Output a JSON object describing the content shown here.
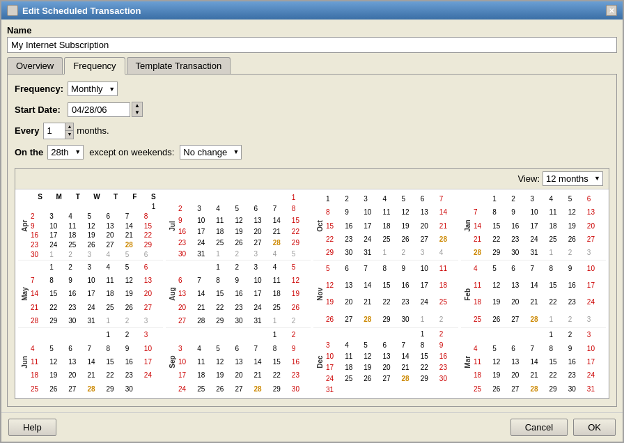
{
  "window": {
    "title": "Edit Scheduled Transaction"
  },
  "name_section": {
    "label": "Name",
    "value": "My Internet Subscription"
  },
  "tabs": [
    {
      "id": "overview",
      "label": "Overview",
      "active": false
    },
    {
      "id": "frequency",
      "label": "Frequency",
      "active": true
    },
    {
      "id": "template",
      "label": "Template Transaction",
      "active": false
    }
  ],
  "form": {
    "frequency_label": "Frequency:",
    "frequency_value": "Monthly",
    "start_date_label": "Start Date:",
    "start_date_value": "04/28/06",
    "every_label": "Every",
    "every_value": "1",
    "every_suffix": "months.",
    "on_the_label": "On the",
    "on_the_value": "28th",
    "except_label": "except on weekends:",
    "except_value": "No change"
  },
  "view": {
    "label": "View:",
    "value": "12 months"
  },
  "buttons": {
    "help": "Help",
    "cancel": "Cancel",
    "ok": "OK"
  },
  "calendars": {
    "months": [
      {
        "label": "Apr",
        "weeks": [
          [
            "",
            "",
            "",
            "",
            "",
            "",
            "1"
          ],
          [
            "2",
            "3",
            "4",
            "5",
            "6",
            "7",
            "8"
          ],
          [
            "9",
            "10",
            "11",
            "12",
            "13",
            "14",
            "15"
          ],
          [
            "16",
            "17",
            "18",
            "19",
            "20",
            "21",
            "22"
          ],
          [
            "23",
            "24",
            "25",
            "26",
            "27",
            "28",
            "29"
          ],
          [
            "30",
            "1",
            "2",
            "3",
            "4",
            "5",
            "6"
          ]
        ],
        "special": [
          "28"
        ],
        "other_month_last_row": [
          "1",
          "2",
          "3",
          "4",
          "5",
          "6"
        ]
      },
      {
        "label": "May",
        "weeks": [
          [
            "",
            "1",
            "2",
            "3",
            "4",
            "5",
            "6"
          ],
          [
            "7",
            "8",
            "9",
            "10",
            "11",
            "12",
            "13"
          ],
          [
            "14",
            "15",
            "16",
            "17",
            "18",
            "19",
            "20"
          ],
          [
            "21",
            "22",
            "23",
            "24",
            "25",
            "26",
            "27"
          ],
          [
            "28",
            "29",
            "30",
            "31",
            "1",
            "2",
            "3"
          ]
        ],
        "special": [
          "28"
        ],
        "other_month_last_row": [
          "1",
          "2",
          "3"
        ]
      },
      {
        "label": "Jun",
        "weeks": [
          [
            "",
            "",
            "",
            "",
            "1",
            "2",
            "3"
          ],
          [
            "4",
            "5",
            "6",
            "7",
            "8",
            "9",
            "10"
          ],
          [
            "11",
            "12",
            "13",
            "14",
            "15",
            "16",
            "17"
          ],
          [
            "18",
            "19",
            "20",
            "21",
            "22",
            "23",
            "24"
          ],
          [
            "25",
            "26",
            "27",
            "28",
            "29",
            "30",
            ""
          ]
        ],
        "special": [
          "28"
        ]
      }
    ]
  },
  "weekdays": [
    "S",
    "M",
    "T",
    "W",
    "T",
    "F",
    "S"
  ]
}
